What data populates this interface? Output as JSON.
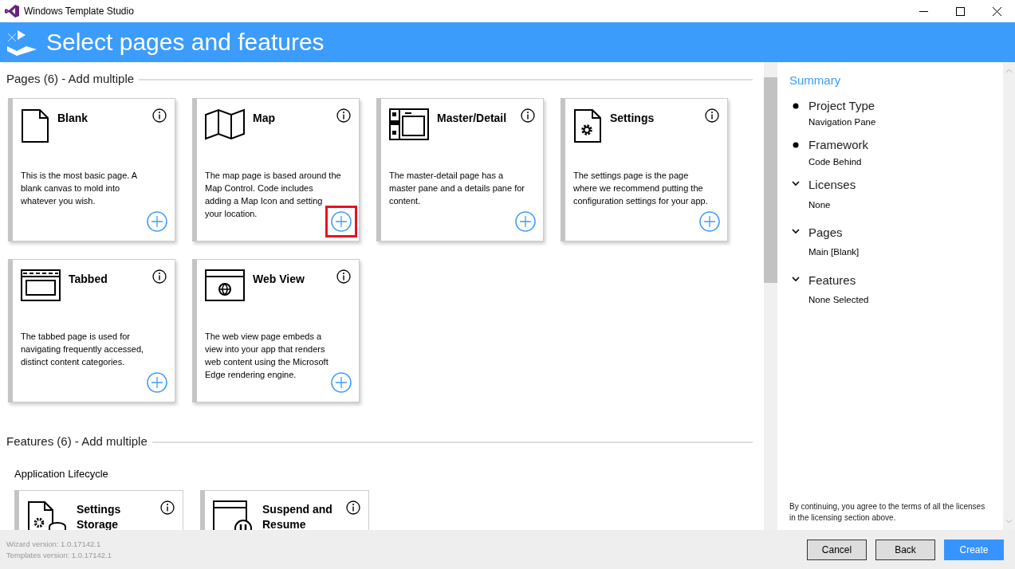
{
  "window": {
    "title": "Windows Template Studio"
  },
  "header": {
    "title": "Select pages and features"
  },
  "pages_section": {
    "heading": "Pages (6) - Add multiple",
    "items": [
      {
        "title": "Blank",
        "description": "This is the most basic page. A blank canvas to mold into whatever you wish.",
        "highlighted": false
      },
      {
        "title": "Map",
        "description": "The map page is based around the Map Control. Code includes adding a Map Icon and setting your location.",
        "highlighted": true
      },
      {
        "title": "Master/Detail",
        "description": "The master-detail page has a master pane and a details pane for content.",
        "highlighted": false
      },
      {
        "title": "Settings",
        "description": "The settings page is the page where we recommend putting the configuration settings for your app.",
        "highlighted": false
      },
      {
        "title": "Tabbed",
        "description": "The tabbed page is used for navigating frequently accessed, distinct content categories.",
        "highlighted": false
      },
      {
        "title": "Web View",
        "description": "The web view page embeds a view into your app that renders web content using the Microsoft Edge rendering engine.",
        "highlighted": false
      }
    ]
  },
  "features_section": {
    "heading": "Features (6) - Add multiple",
    "groups": [
      {
        "title": "Application Lifecycle",
        "items": [
          {
            "title": "Settings Storage"
          },
          {
            "title": "Suspend and Resume"
          }
        ]
      }
    ]
  },
  "summary": {
    "title": "Summary",
    "items": [
      {
        "kind": "bullet",
        "label": "Project Type",
        "value": "Navigation Pane"
      },
      {
        "kind": "bullet",
        "label": "Framework",
        "value": "Code Behind"
      },
      {
        "kind": "expander",
        "label": "Licenses",
        "value": "None"
      },
      {
        "kind": "expander",
        "label": "Pages",
        "value": "Main [Blank]"
      },
      {
        "kind": "expander",
        "label": "Features",
        "value": "None Selected"
      }
    ],
    "notice": "By continuing, you agree to the terms of all the licenses in the licensing section above."
  },
  "footer": {
    "versions": [
      "Wizard version: 1.0.17142.1",
      "Templates version: 1.0.17142.1"
    ],
    "buttons": [
      {
        "label": "Cancel",
        "kind": "secondary"
      },
      {
        "label": "Back",
        "kind": "secondary"
      },
      {
        "label": "Create",
        "kind": "primary"
      }
    ]
  }
}
